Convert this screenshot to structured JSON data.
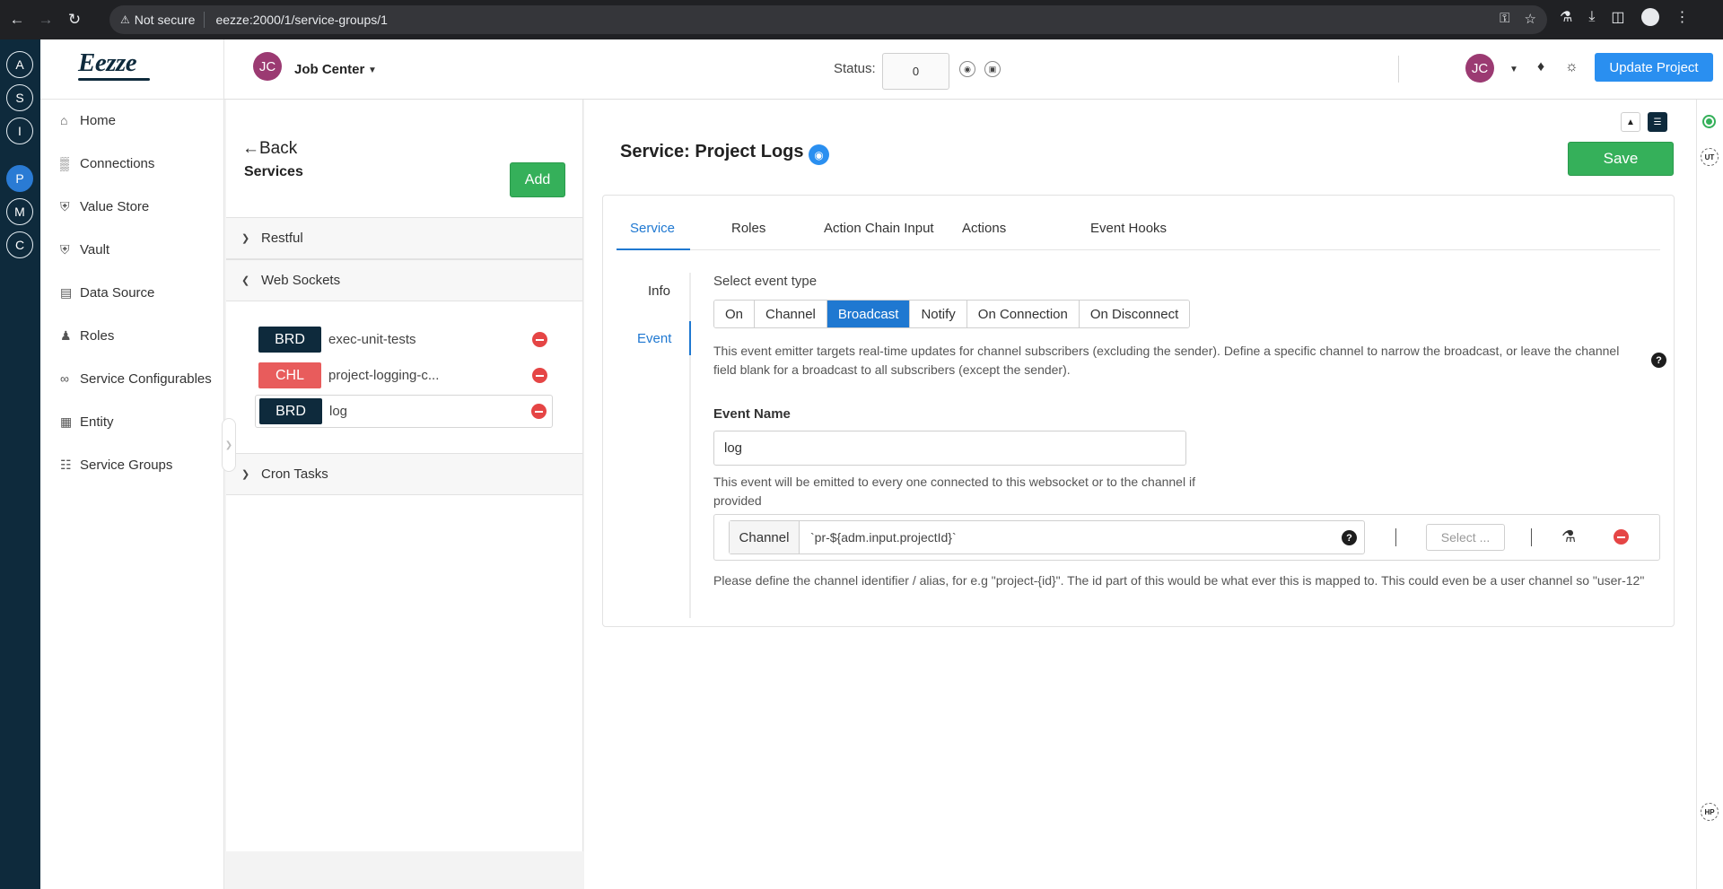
{
  "browser": {
    "not_secure": "Not secure",
    "url": "eezze:2000/1/service-groups/1"
  },
  "rail": [
    "A",
    "S",
    "I",
    "P",
    "M",
    "C"
  ],
  "logo": "Eezze",
  "sidebar": {
    "items": [
      {
        "label": "Home",
        "icon": "home-icon"
      },
      {
        "label": "Connections",
        "icon": "chart-icon"
      },
      {
        "label": "Value Store",
        "icon": "shield-icon"
      },
      {
        "label": "Vault",
        "icon": "shield-icon"
      },
      {
        "label": "Data Source",
        "icon": "database-icon"
      },
      {
        "label": "Roles",
        "icon": "users-icon"
      },
      {
        "label": "Service Configurables",
        "icon": "paperclip-icon"
      },
      {
        "label": "Entity",
        "icon": "table-icon"
      },
      {
        "label": "Service Groups",
        "icon": "grid-icon"
      }
    ]
  },
  "header": {
    "avatar_initials": "JC",
    "project_name": "Job Center",
    "status_label": "Status:",
    "status_value": "0",
    "user_initials": "JC",
    "update_button": "Update Project"
  },
  "services_panel": {
    "back_label": "Back",
    "title": "Services",
    "add_button": "Add",
    "groups": [
      {
        "label": "Restful",
        "expanded": false
      },
      {
        "label": "Web Sockets",
        "expanded": true
      },
      {
        "label": "Cron Tasks",
        "expanded": false
      }
    ],
    "items": [
      {
        "tag": "BRD",
        "name": "exec-unit-tests",
        "selected": false
      },
      {
        "tag": "CHL",
        "name": "project-logging-c...",
        "selected": false
      },
      {
        "tag": "BRD",
        "name": "log",
        "selected": true
      }
    ]
  },
  "main": {
    "title": "Service: Project Logs",
    "save_button": "Save",
    "tabs": [
      "Service",
      "Roles",
      "Action Chain Input",
      "Actions",
      "Event Hooks"
    ],
    "active_tab": "Service",
    "subnav": [
      "Info",
      "Event"
    ],
    "active_subnav": "Event",
    "event_type_label": "Select event type",
    "event_types": [
      "On",
      "Channel",
      "Broadcast",
      "Notify",
      "On Connection",
      "On Disconnect"
    ],
    "selected_event_type": "Broadcast",
    "event_description": "This event emitter targets real-time updates for channel subscribers (excluding the sender). Define a specific channel to narrow the broadcast, or leave the channel field blank for a broadcast to all subscribers (except the sender).",
    "event_name_label": "Event Name",
    "event_name_value": "log",
    "event_name_hint": "This event will be emitted to every one connected to this websocket or to the channel if provided",
    "channel_label": "Channel",
    "channel_value": "`pr-${adm.input.projectId}`",
    "select_placeholder": "Select ...",
    "channel_hint": "Please define the channel identifier / alias, for e.g \"project-{id}\". The id part of this would be what ever this is mapped to. This could even be a user channel so \"user-12\""
  },
  "right_strip": {
    "badge_top": "UT",
    "badge_bottom": "HP"
  },
  "colors": {
    "rail": "#0e2a3c",
    "primary": "#1f78d1",
    "success": "#35b05a",
    "danger": "#e54545",
    "chl_tag": "#e85c5c"
  }
}
